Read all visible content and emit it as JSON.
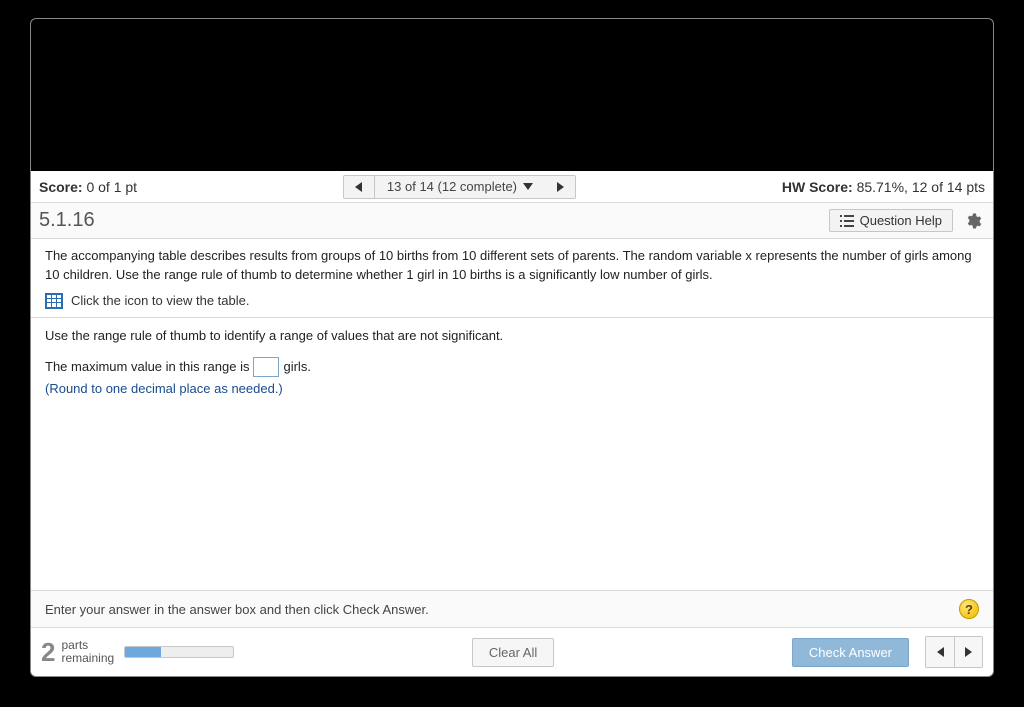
{
  "score_bar": {
    "score_label": "Score:",
    "score_value": "0 of 1 pt",
    "nav_position": "13 of 14 (12 complete)",
    "hw_score_label": "HW Score:",
    "hw_score_value": "85.71%, 12 of 14 pts"
  },
  "question": {
    "number": "5.1.16",
    "help_label": "Question Help",
    "text": "The accompanying table describes results from groups of 10 births from 10 different sets of parents. The random variable x represents the number of girls among 10 children. Use the range rule of thumb to determine whether 1 girl in 10 births is a significantly low number of girls.",
    "table_link": "Click the icon to view the table.",
    "sub_instruction": "Use the range rule of thumb to identify a range of values that are not significant.",
    "answer_before": "The maximum value in this range is",
    "answer_after": "girls.",
    "round_note": "(Round to one decimal place as needed.)"
  },
  "instruction_bar": {
    "text": "Enter your answer in the answer box and then click Check Answer.",
    "help_symbol": "?"
  },
  "footer": {
    "parts_count": "2",
    "parts_label_1": "parts",
    "parts_label_2": "remaining",
    "progress_percent": 33,
    "clear_all": "Clear All",
    "check_answer": "Check Answer"
  }
}
